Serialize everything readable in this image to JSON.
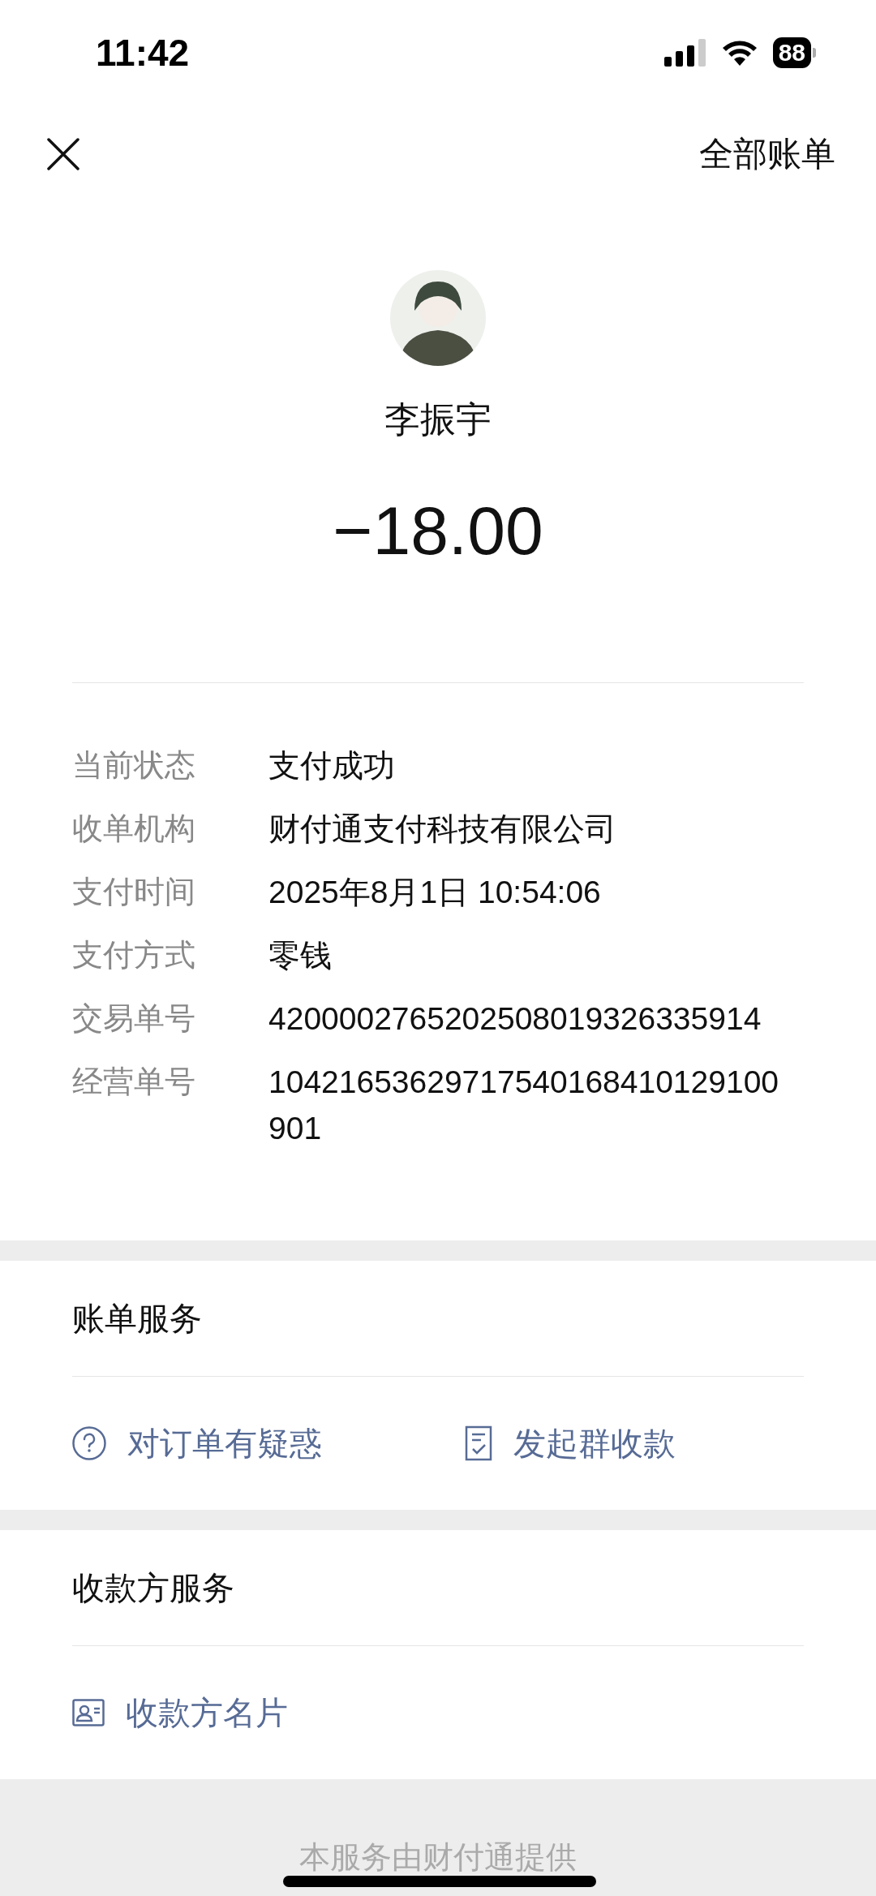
{
  "status_bar": {
    "time": "11:42",
    "battery": "88"
  },
  "nav": {
    "action": "全部账单"
  },
  "payee": {
    "name": "李振宇",
    "amount": "−18.00"
  },
  "details": [
    {
      "label": "当前状态",
      "value": "支付成功"
    },
    {
      "label": "收单机构",
      "value": "财付通支付科技有限公司"
    },
    {
      "label": "支付时间",
      "value": "2025年8月1日 10:54:06"
    },
    {
      "label": "支付方式",
      "value": "零钱"
    },
    {
      "label": "交易单号",
      "value": "4200002765202508019326335914"
    },
    {
      "label": "经营单号",
      "value": "10421653629717540168410129100901"
    }
  ],
  "sections": [
    {
      "title": "账单服务",
      "actions": [
        {
          "kind": "question",
          "label": "对订单有疑惑"
        },
        {
          "kind": "receipt",
          "label": "发起群收款"
        }
      ]
    },
    {
      "title": "收款方服务",
      "actions": [
        {
          "kind": "card",
          "label": "收款方名片"
        }
      ]
    }
  ],
  "footer": "本服务由财付通提供"
}
